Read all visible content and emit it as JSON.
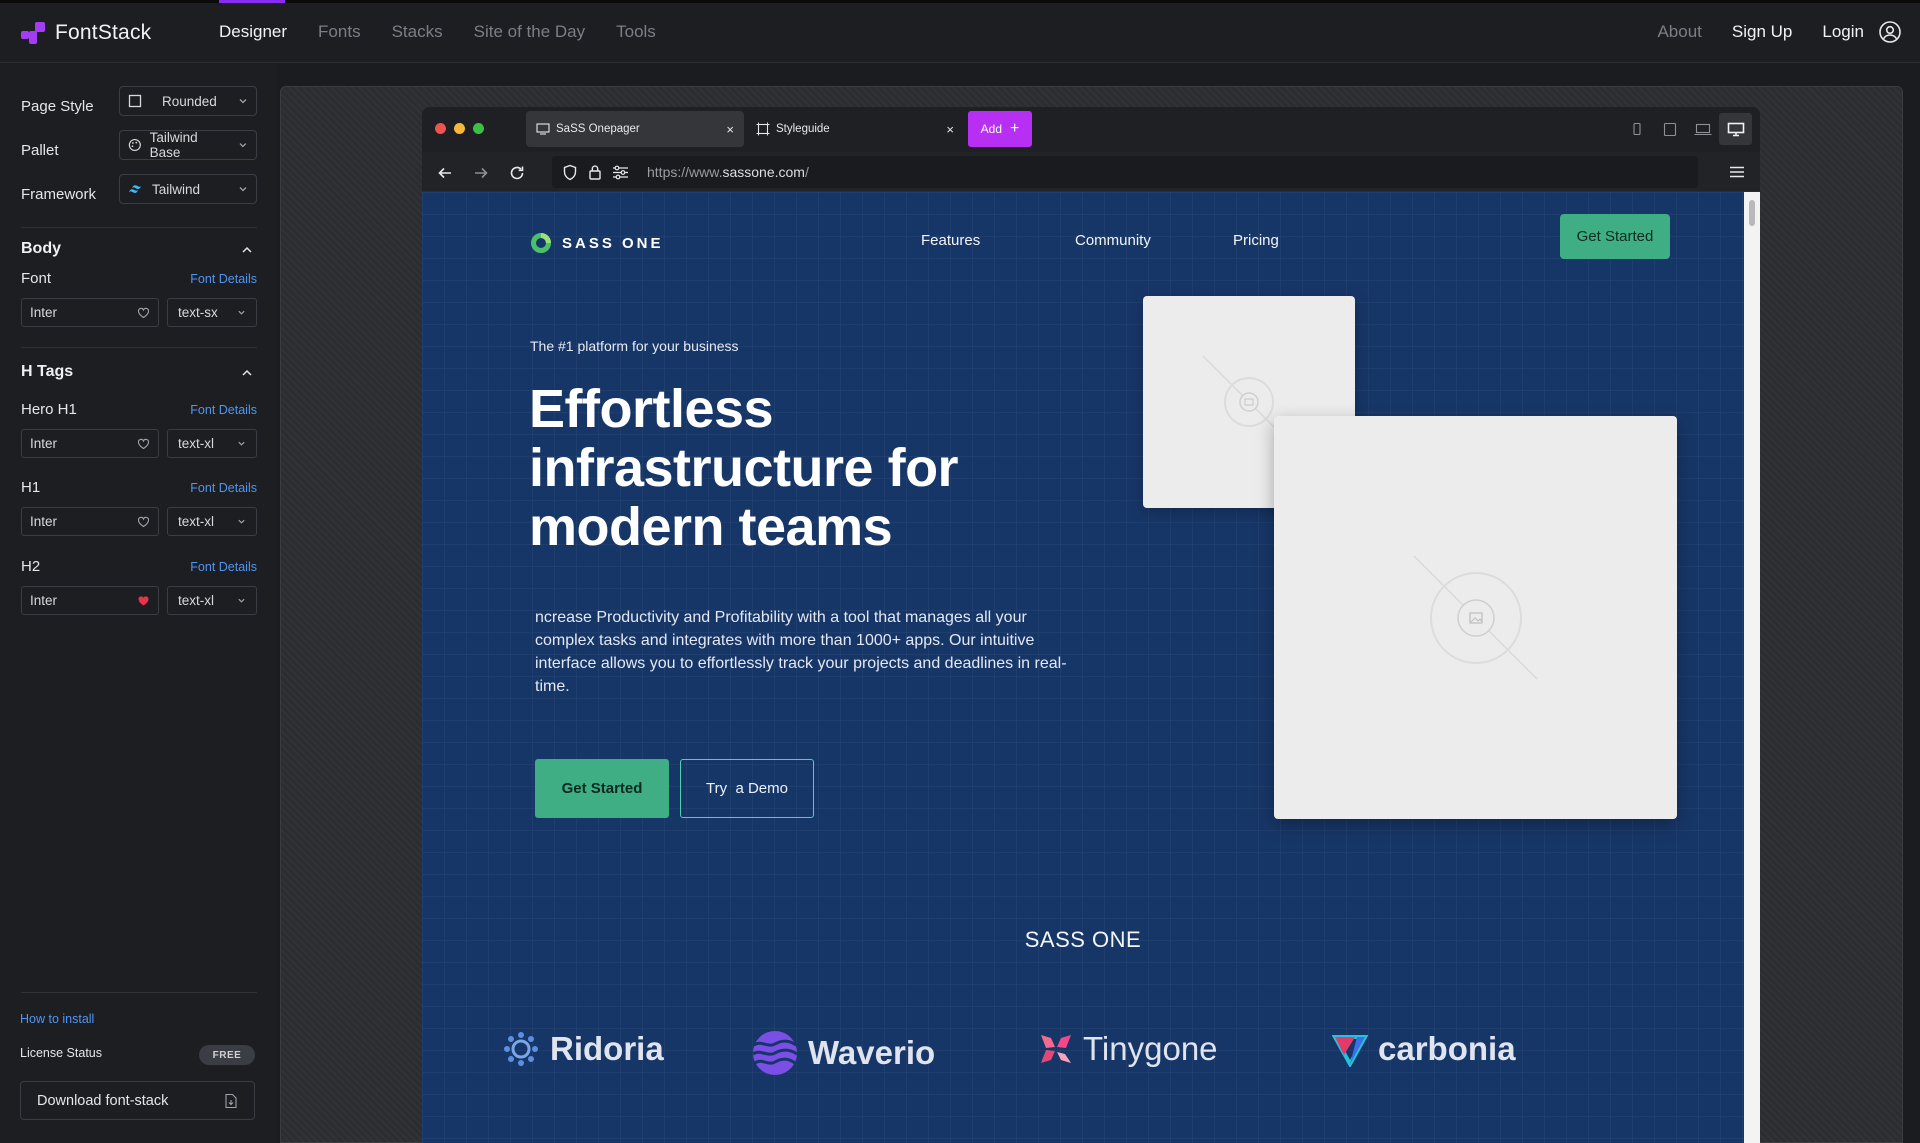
{
  "app": {
    "name": "FontStack"
  },
  "nav": {
    "items": [
      {
        "label": "Designer",
        "active": true
      },
      {
        "label": "Fonts",
        "active": false
      },
      {
        "label": "Stacks",
        "active": false
      },
      {
        "label": "Site of the Day",
        "active": false
      },
      {
        "label": "Tools",
        "active": false
      }
    ],
    "about": "About",
    "signup": "Sign Up",
    "login": "Login"
  },
  "sidebar": {
    "page_style": {
      "label": "Page Style",
      "value": "Rounded"
    },
    "pallet": {
      "label": "Pallet",
      "value": "Tailwind Base"
    },
    "framework": {
      "label": "Framework",
      "value": "Tailwind"
    },
    "body": {
      "title": "Body",
      "font_label": "Font",
      "details": "Font Details",
      "font": "Inter",
      "size": "text-sx"
    },
    "htags": {
      "title": "H Tags",
      "details": "Font Details",
      "rows": [
        {
          "label": "Hero H1",
          "font": "Inter",
          "size": "text-xl",
          "favorite": false
        },
        {
          "label": "H1",
          "font": "Inter",
          "size": "text-xl",
          "favorite": false
        },
        {
          "label": "H2",
          "font": "Inter",
          "size": "text-xl",
          "favorite": true
        }
      ]
    },
    "how_to_install": "How to install",
    "license_label": "License Status",
    "license_badge": "FREE",
    "download": "Download font-stack"
  },
  "browser": {
    "tabs": [
      {
        "label": "SaSS Onepager",
        "active": true
      },
      {
        "label": "Styleguide",
        "active": false
      }
    ],
    "add_label": "Add",
    "url_prefix": "https://www.",
    "url_domain": "sassone.com",
    "url_suffix": "/"
  },
  "site": {
    "logo": "SASS ONE",
    "nav": [
      "Features",
      "Community",
      "Pricing"
    ],
    "cta": "Get Started",
    "eyebrow": "The #1 platform for your business",
    "headline": "Effortless infrastructure for modern teams",
    "paragraph": "ncrease Productivity and Profitability with a tool that manages all your complex tasks and integrates with more than 1000+ apps. Our intuitive interface allows you to effortlessly track your projects and deadlines in real-time.",
    "btn_primary": "Get Started",
    "btn_secondary": "Try  a Demo",
    "brand_heading": "SASS ONE",
    "logos": [
      "Ridoria",
      "Waverio",
      "Tinygone",
      "carbonia"
    ]
  },
  "colors": {
    "accent_purple": "#8b2cf5",
    "add_button": "#b62ff2",
    "link_blue": "#4f95f2",
    "site_bg": "#173668",
    "site_green": "#3fae84",
    "heart_red": "#e8344a"
  }
}
